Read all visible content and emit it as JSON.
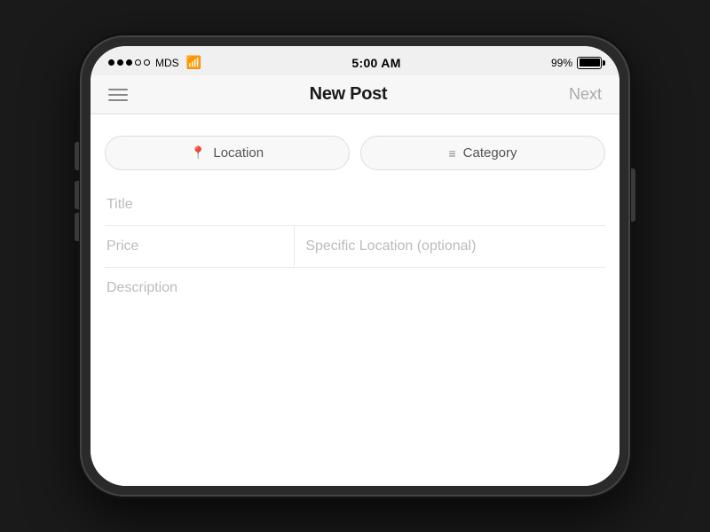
{
  "statusBar": {
    "carrier": "MDS",
    "time": "5:00 AM",
    "battery_percent": "99%",
    "signal_filled": 3,
    "signal_empty": 2
  },
  "navBar": {
    "title": "New Post",
    "next_label": "Next",
    "menu_icon": "hamburger"
  },
  "filters": {
    "location_label": "Location",
    "category_label": "Category"
  },
  "form": {
    "title_placeholder": "Title",
    "price_placeholder": "Price",
    "specific_location_placeholder": "Specific Location (optional)",
    "description_placeholder": "Description"
  }
}
